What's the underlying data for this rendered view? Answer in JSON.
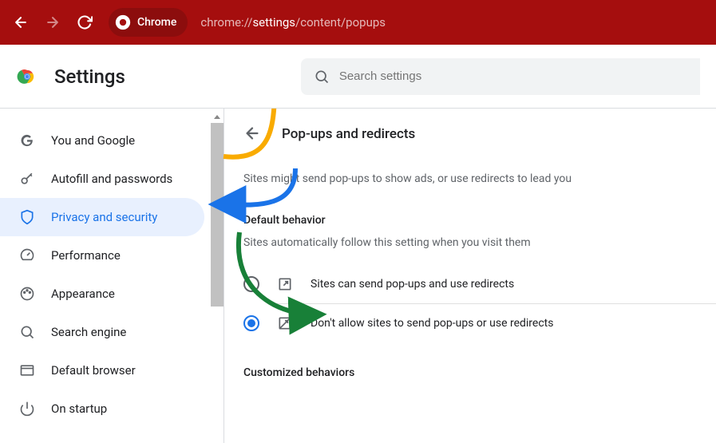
{
  "browser": {
    "chip_label": "Chrome",
    "url_pre": "chrome://",
    "url_hl": "settings",
    "url_post": "/content/popups"
  },
  "header": {
    "title": "Settings",
    "search_placeholder": "Search settings"
  },
  "sidebar": {
    "items": [
      {
        "label": "You and Google"
      },
      {
        "label": "Autofill and passwords"
      },
      {
        "label": "Privacy and security"
      },
      {
        "label": "Performance"
      },
      {
        "label": "Appearance"
      },
      {
        "label": "Search engine"
      },
      {
        "label": "Default browser"
      },
      {
        "label": "On startup"
      }
    ]
  },
  "content": {
    "page_title": "Pop-ups and redirects",
    "description": "Sites might send pop-ups to show ads, or use redirects to lead you",
    "default_behavior_hdr": "Default behavior",
    "default_behavior_sub": "Sites automatically follow this setting when you visit them",
    "option_allow": "Sites can send pop-ups and use redirects",
    "option_block": "Don't allow sites to send pop-ups or use redirects",
    "customized_hdr": "Customized behaviors"
  }
}
